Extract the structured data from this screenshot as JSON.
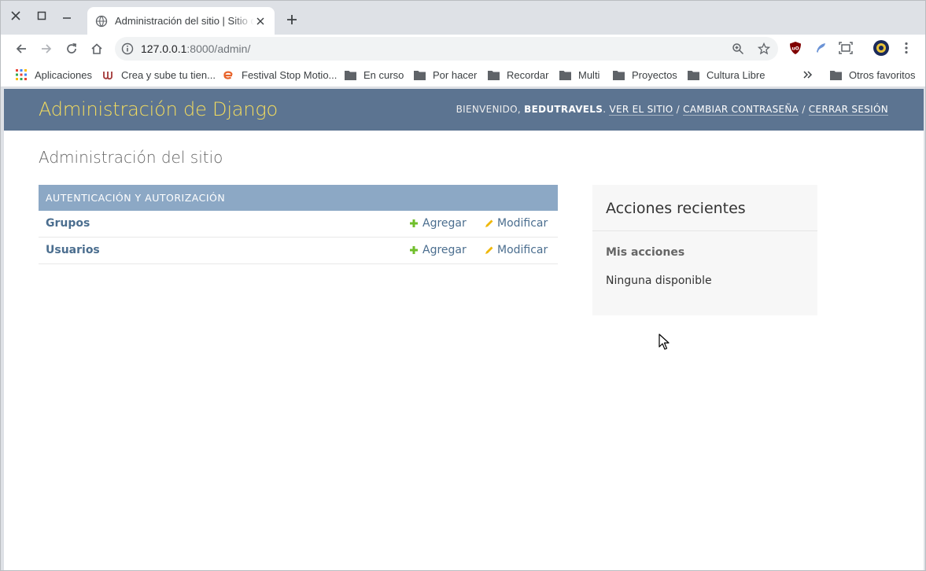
{
  "browser": {
    "tab": {
      "title": "Administración del sitio | Sitio de administración de Django"
    },
    "url": {
      "host": "127.0.0.1",
      "rest": ":8000/admin/"
    },
    "bookmarks": [
      {
        "label": "Aplicaciones",
        "icon": "apps-grid-icon"
      },
      {
        "label": "Crea y sube tu tien...",
        "icon": "udemy-icon"
      },
      {
        "label": "Festival Stop Motio...",
        "icon": "e-logo-icon"
      },
      {
        "label": "En curso",
        "icon": "folder-icon"
      },
      {
        "label": "Por hacer",
        "icon": "folder-icon"
      },
      {
        "label": "Recordar",
        "icon": "folder-icon"
      },
      {
        "label": "Multi",
        "icon": "folder-icon"
      },
      {
        "label": "Proyectos",
        "icon": "folder-icon"
      },
      {
        "label": "Cultura Libre",
        "icon": "folder-icon"
      }
    ],
    "other_bookmarks": "Otros favoritos"
  },
  "header": {
    "branding": "Administración de Django",
    "welcome": "BIENVENIDO,",
    "username": "BEDUTRAVELS",
    "links": {
      "view_site": "VER EL SITIO",
      "change_password": "CAMBIAR CONTRASEÑA",
      "logout": "CERRAR SESIÓN"
    },
    "separator": "/"
  },
  "content": {
    "title": "Administración del sitio",
    "module": {
      "caption": "AUTENTICACIÓN Y AUTORIZACIÓN",
      "models": [
        {
          "name": "Grupos",
          "add": "Agregar",
          "change": "Modificar"
        },
        {
          "name": "Usuarios",
          "add": "Agregar",
          "change": "Modificar"
        }
      ]
    },
    "recent_actions": {
      "title": "Acciones recientes",
      "subtitle": "Mis acciones",
      "empty": "Ninguna disponible"
    }
  },
  "colors": {
    "header_bg": "#5c7491",
    "branding": "#f5dd5d",
    "caption_bg": "#8ca8c5",
    "link": "#4b6e8f",
    "add_icon": "#70bf2b",
    "change_icon": "#efb80b"
  }
}
